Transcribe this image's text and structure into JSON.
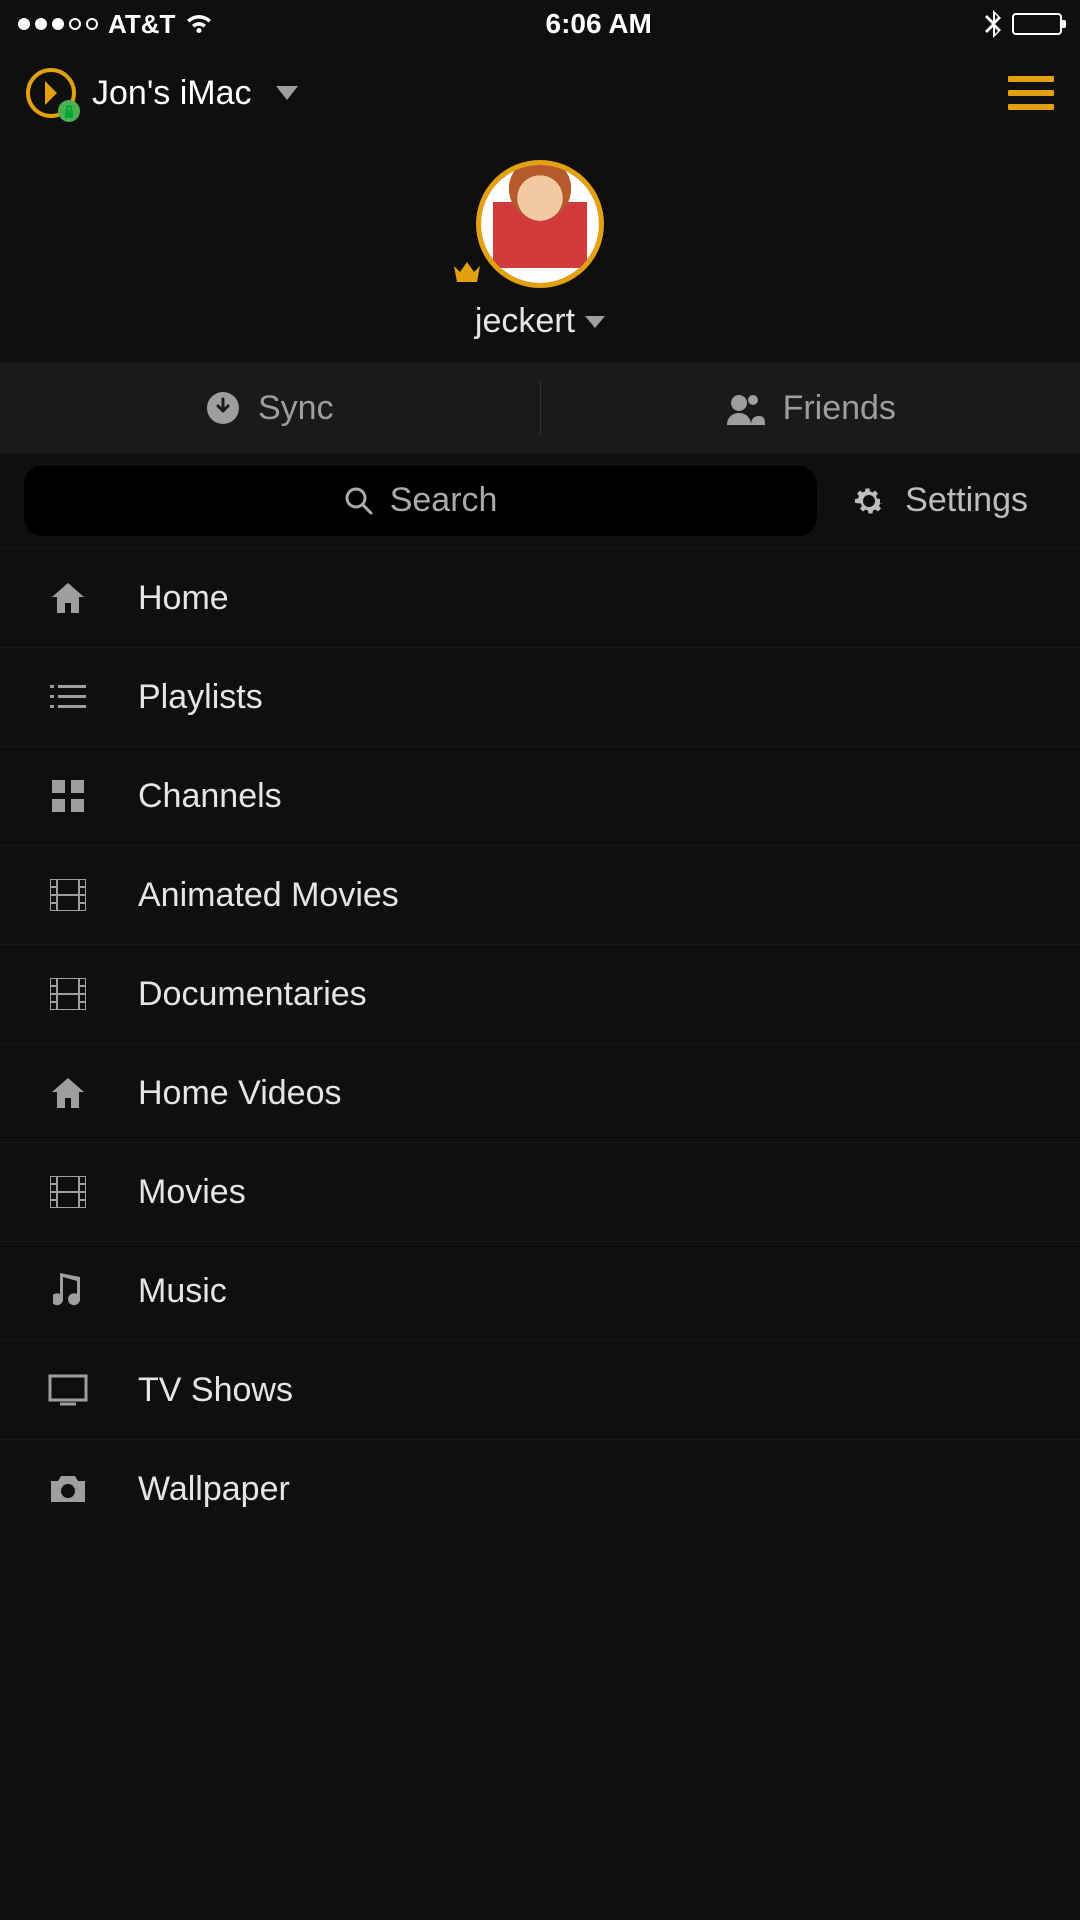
{
  "status_bar": {
    "carrier": "AT&T",
    "time": "6:06 AM"
  },
  "header": {
    "server_name": "Jon's iMac"
  },
  "profile": {
    "username": "jeckert"
  },
  "action_bar": {
    "sync_label": "Sync",
    "friends_label": "Friends"
  },
  "utility": {
    "search_placeholder": "Search",
    "settings_label": "Settings"
  },
  "nav": {
    "items": [
      {
        "label": "Home",
        "icon": "home"
      },
      {
        "label": "Playlists",
        "icon": "list"
      },
      {
        "label": "Channels",
        "icon": "grid"
      },
      {
        "label": "Animated Movies",
        "icon": "film"
      },
      {
        "label": "Documentaries",
        "icon": "film"
      },
      {
        "label": "Home Videos",
        "icon": "home"
      },
      {
        "label": "Movies",
        "icon": "film"
      },
      {
        "label": "Music",
        "icon": "music"
      },
      {
        "label": "TV Shows",
        "icon": "tv"
      },
      {
        "label": "Wallpaper",
        "icon": "camera"
      }
    ]
  },
  "colors": {
    "accent": "#e5a00d",
    "bg": "#0f0f0f"
  }
}
